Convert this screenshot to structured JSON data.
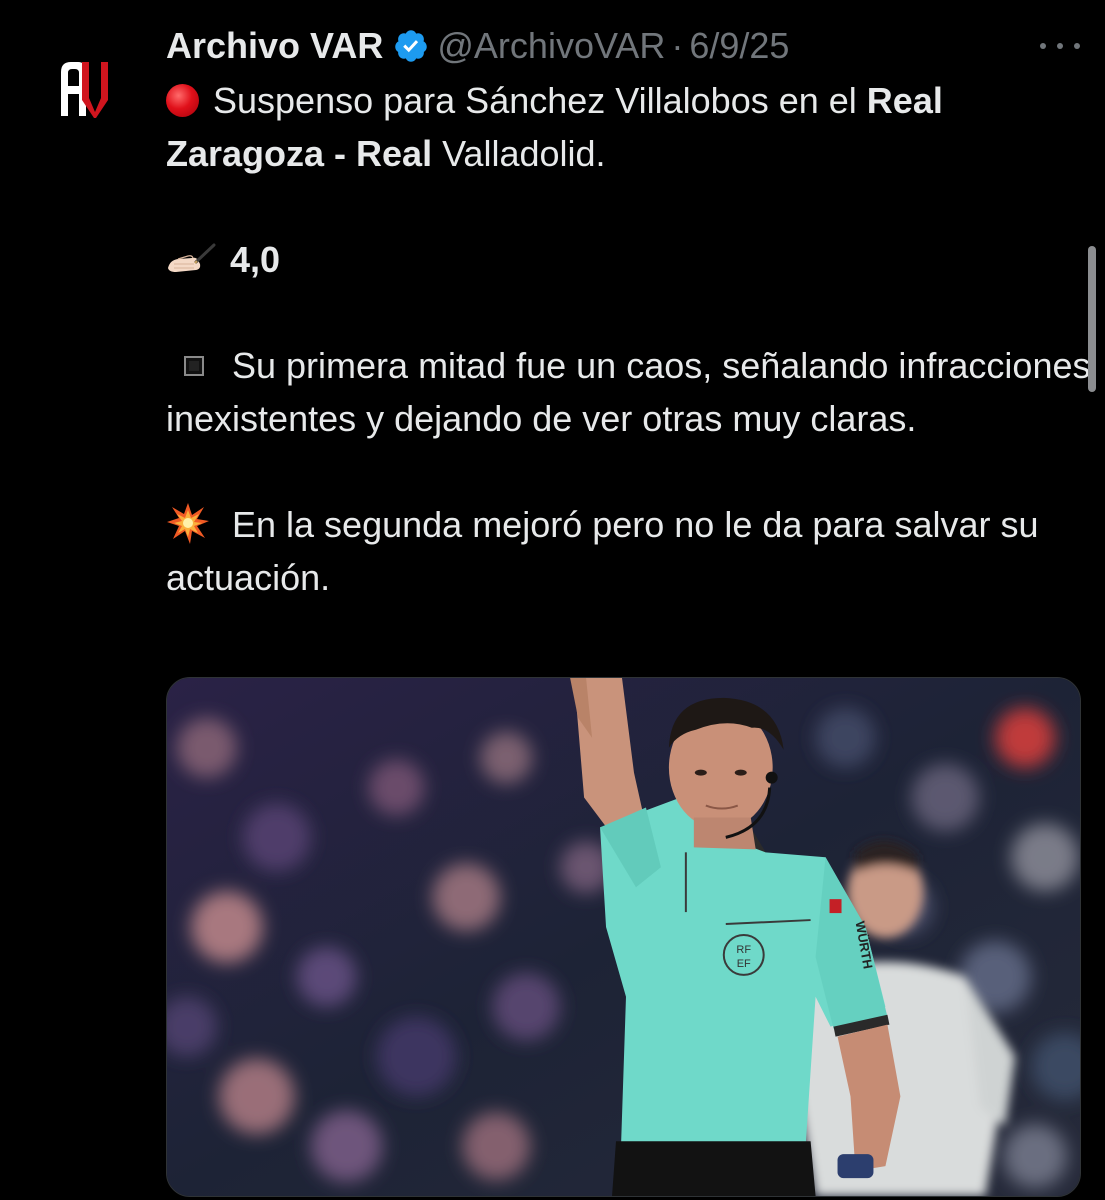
{
  "tweet": {
    "display_name": "Archivo VAR",
    "handle": "@ArchivoVAR",
    "separator": "·",
    "date": "6/9/25",
    "avatar_icon": "archivo-var-logo-icon",
    "verified_icon": "verified-badge-icon",
    "more_icon": "more-options-icon",
    "lines": {
      "l1_prefix": "Suspenso para Sánchez Villalobos en el ",
      "l1_bold": "Real",
      "l2_bold1": "Zaragoza - Real",
      "l2_rest": " Valladolid.",
      "rating": "4,0",
      "p1": "Su primera mitad fue un caos, señalando infracciones inexistentes y dejando de ver otras muy claras.",
      "p2": "En la segunda mejoró pero no le da para salvar su actuación."
    },
    "media": {
      "kit_sponsor": "WÜRTH",
      "badge_line1": "RF",
      "badge_line2": "EF"
    }
  },
  "colors": {
    "background": "#000000",
    "text": "#e7e9ea",
    "muted": "#71767b",
    "verified": "#1d9bf0",
    "logo_red": "#d0151e",
    "referee_shirt": "#6fd9c9"
  }
}
